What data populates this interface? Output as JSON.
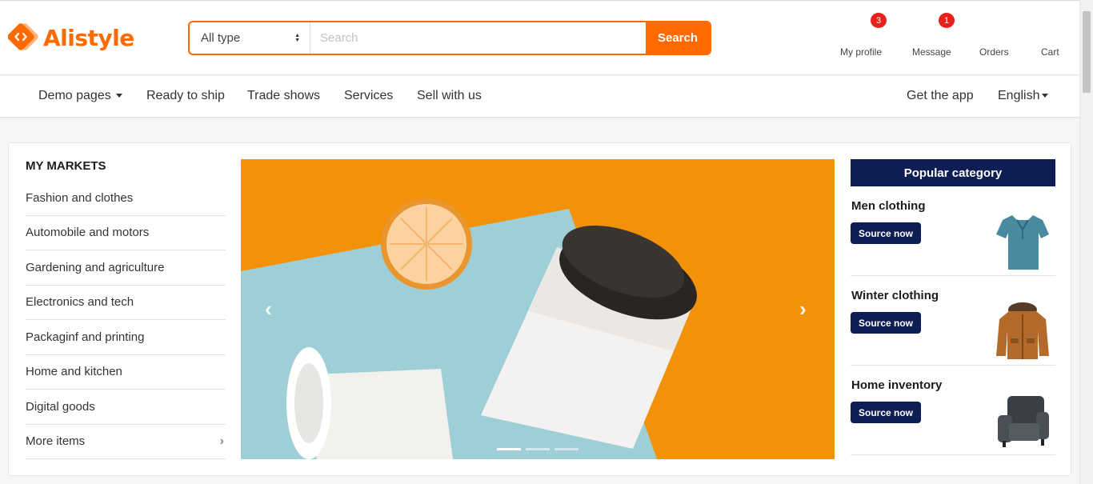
{
  "brand": {
    "name": "Alistyle",
    "color": "#ff6a00"
  },
  "search": {
    "type_value": "All type",
    "placeholder": "Search",
    "button": "Search"
  },
  "header_links": [
    {
      "label": "My profile",
      "badge": "3"
    },
    {
      "label": "Message",
      "badge": "1"
    },
    {
      "label": "Orders"
    },
    {
      "label": "Cart"
    }
  ],
  "nav": {
    "left": [
      "Demo pages",
      "Ready to ship",
      "Trade shows",
      "Services",
      "Sell with us"
    ],
    "right": [
      "Get the app",
      "English"
    ]
  },
  "markets": {
    "title": "MY MARKETS",
    "items": [
      "Fashion and clothes",
      "Automobile and motors",
      "Gardening and agriculture",
      "Electronics and tech",
      "Packaginf and printing",
      "Home and kitchen",
      "Digital goods",
      "More items"
    ]
  },
  "banner": {
    "slide_count": 3,
    "active_slide": 1
  },
  "popular": {
    "title": "Popular category",
    "items": [
      {
        "name": "Men clothing",
        "button": "Source now",
        "icon": "polo-shirt-icon"
      },
      {
        "name": "Winter clothing",
        "button": "Source now",
        "icon": "winter-jacket-icon"
      },
      {
        "name": "Home inventory",
        "button": "Source now",
        "icon": "armchair-icon"
      }
    ]
  },
  "colors": {
    "accent": "#ff6a00",
    "navy": "#0e1e54",
    "badge": "#e8201d",
    "banner_bg": "#f2910a",
    "paper": "#9fcfd6"
  }
}
